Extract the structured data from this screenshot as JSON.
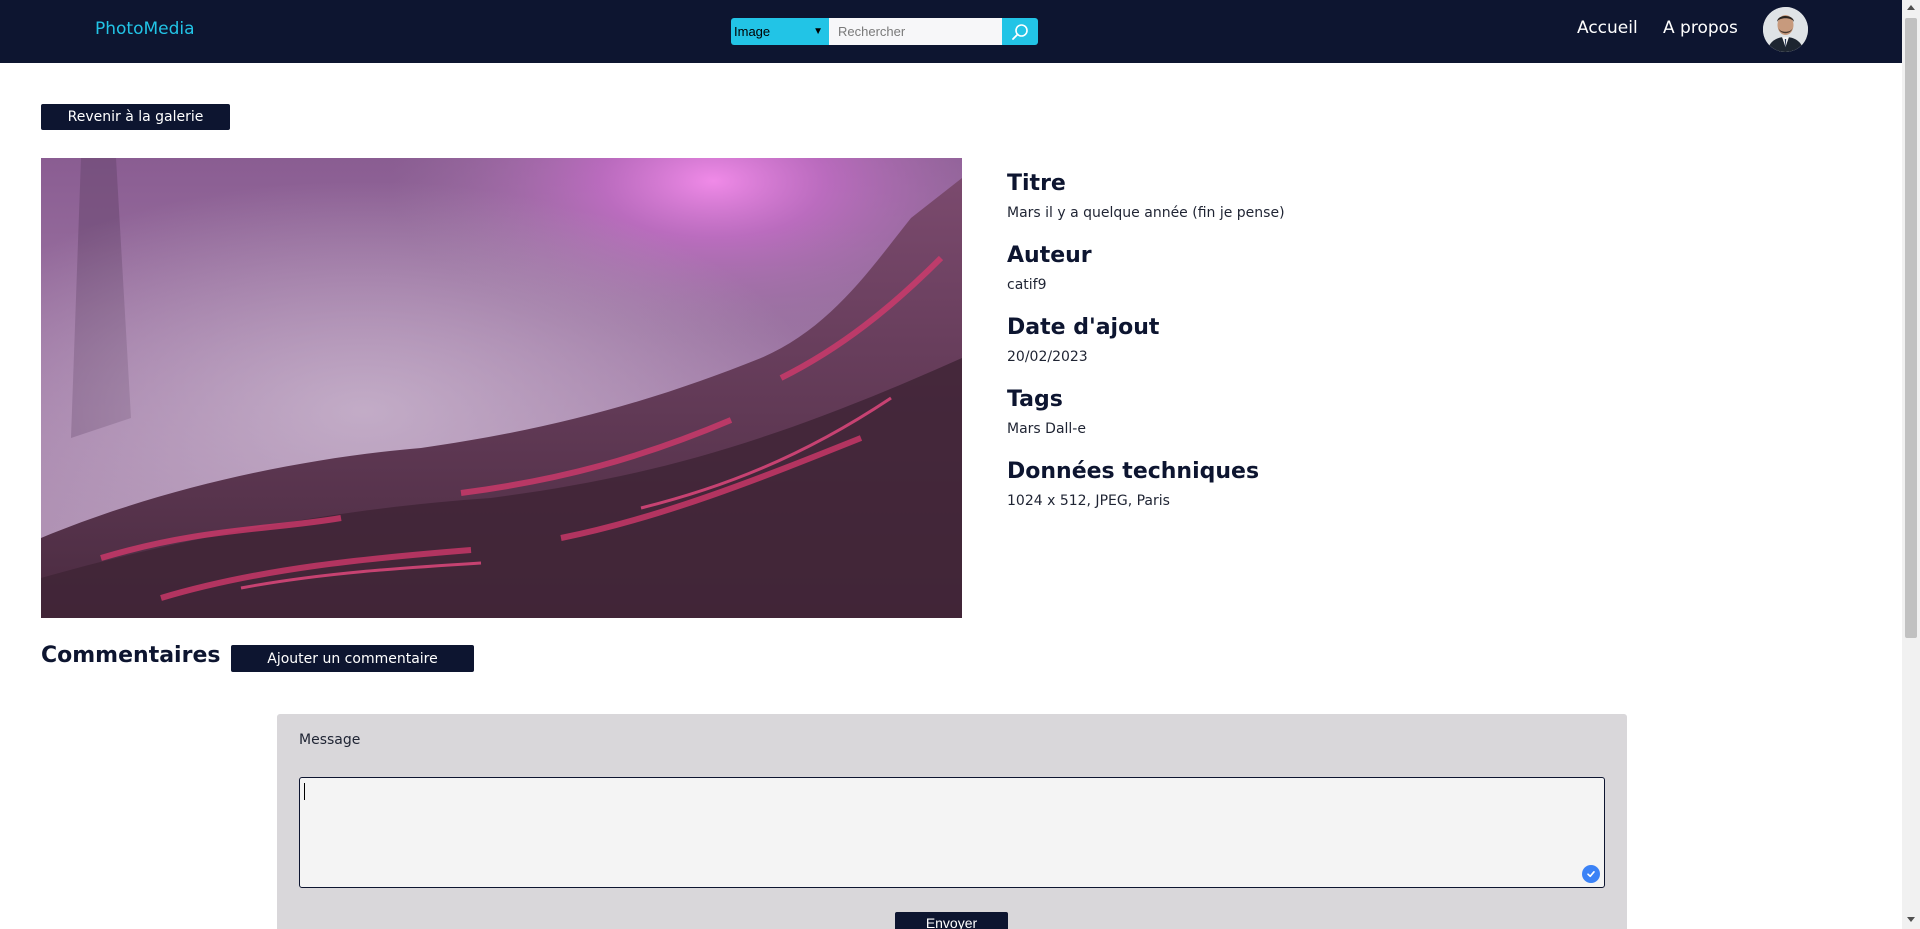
{
  "header": {
    "brand": "PhotoMedia",
    "search": {
      "type_selected": "Image",
      "placeholder": "Rechercher"
    },
    "nav": {
      "home": "Accueil",
      "about": "A propos"
    }
  },
  "main": {
    "back_label": "Revenir à la galerie",
    "details": {
      "title_heading": "Titre",
      "title_value": "Mars il y a quelque année (fin je pense)",
      "author_heading": "Auteur",
      "author_value": "catif9",
      "date_heading": "Date d'ajout",
      "date_value": "20/02/2023",
      "tags_heading": "Tags",
      "tags_value": "Mars Dall-e",
      "tech_heading": "Données techniques",
      "tech_value": "1024 x 512, JPEG, Paris"
    },
    "comments": {
      "heading": "Commentaires",
      "add_label": "Ajouter un commentaire",
      "form": {
        "message_label": "Message",
        "submit_label": "Envoyer"
      }
    }
  },
  "colors": {
    "navy": "#0d1530",
    "accent": "#22c4e6",
    "form_bg": "#d9d7da"
  }
}
